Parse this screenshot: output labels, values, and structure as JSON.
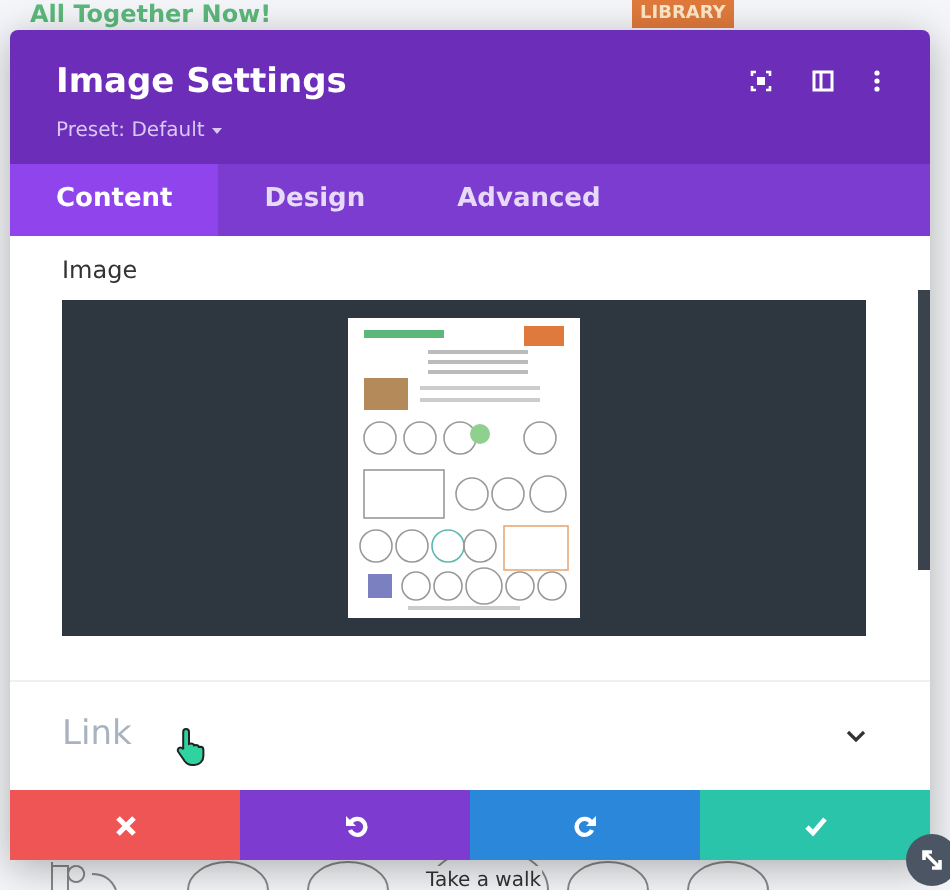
{
  "background": {
    "heading": "All Together Now!",
    "badge": "LIBRARY",
    "caption": "Take a walk"
  },
  "modal": {
    "title": "Image Settings",
    "preset": "Preset: Default"
  },
  "tabs": [
    {
      "label": "Content",
      "selected": true
    },
    {
      "label": "Design",
      "selected": false
    },
    {
      "label": "Advanced",
      "selected": false
    }
  ],
  "image_field": {
    "label": "Image"
  },
  "link_section": {
    "label": "Link",
    "expanded": false
  },
  "actions": [
    {
      "kind": "cancel"
    },
    {
      "kind": "undo"
    },
    {
      "kind": "redo"
    },
    {
      "kind": "save"
    }
  ]
}
